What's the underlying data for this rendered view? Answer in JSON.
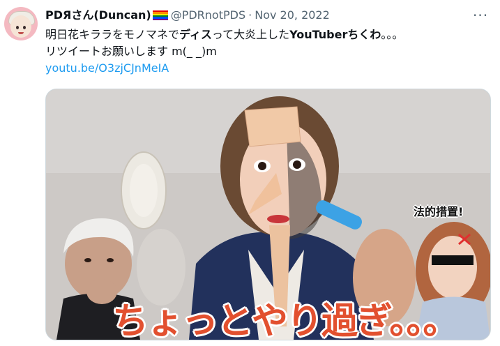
{
  "tweet": {
    "display_name": "PDЯさん(Duncan)",
    "handle": "@PDRnotPDS",
    "separator": "·",
    "date": "Nov 20, 2022",
    "more_icon": "···",
    "text_line1_a": "明日花キララをモノマネで",
    "text_line1_b": "ディス",
    "text_line1_c": "って大炎上した",
    "text_line1_d": "YouTuberちくわ",
    "text_line1_e": "。。。",
    "text_line2": "リツイートお願いします m(_ _)m",
    "link": "youtu.be/O3zjCJnMeIA"
  },
  "media": {
    "caption": "ちょっとやり過ぎ。。。",
    "legal_text": "法的措置!"
  },
  "colors": {
    "link": "#1d9bf0",
    "secondary_text": "#536471",
    "caption": "#e2502f"
  },
  "icons": {
    "avatar": "avatar-icon",
    "flag": "rainbow-flag-icon",
    "more": "more-dots-icon"
  }
}
